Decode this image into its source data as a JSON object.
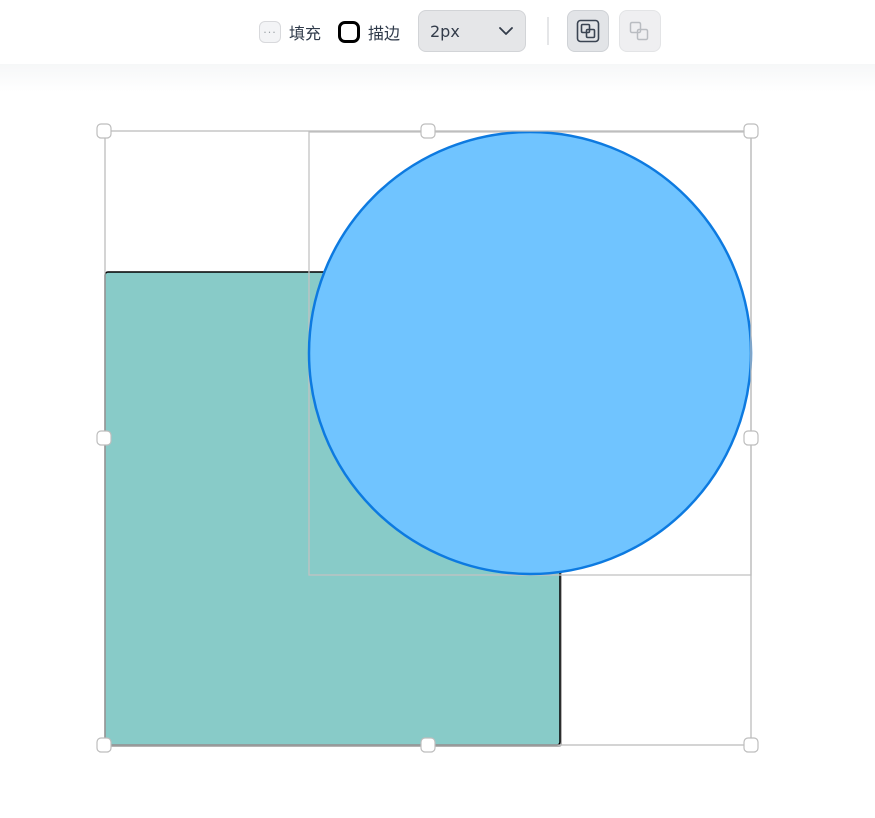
{
  "toolbar": {
    "fill": {
      "label": "填充",
      "icon": "ellipsis-swatch-icon",
      "dots": "···"
    },
    "stroke": {
      "label": "描边",
      "icon": "stroke-swatch-icon"
    },
    "stroke_width": {
      "value": "2px",
      "icon": "chevron-down-icon"
    },
    "buttons": [
      {
        "name": "union-selection-button",
        "icon": "union-shapes-icon",
        "state": "active"
      },
      {
        "name": "subtract-selection-button",
        "icon": "subtract-shapes-icon",
        "state": "disabled"
      }
    ]
  },
  "canvas": {
    "shapes": [
      {
        "name": "teal-rectangle",
        "fill": "#88cbc8",
        "stroke": "#000000"
      },
      {
        "name": "blue-circle",
        "fill": "#70c4ff",
        "stroke": "#0d7ae0"
      }
    ],
    "selection": {
      "handle_count": 8,
      "stroke": "#bdbdbd"
    }
  }
}
